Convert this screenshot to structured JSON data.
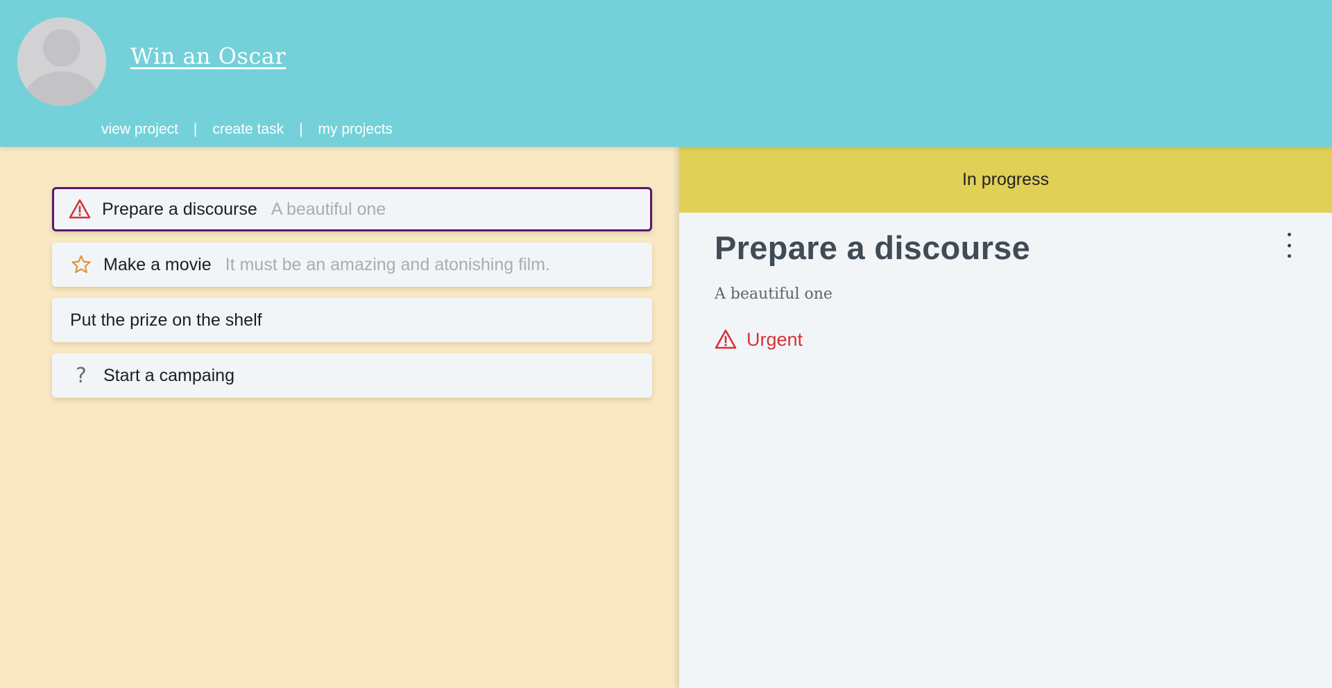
{
  "header": {
    "project_title": "Win an Oscar",
    "nav": [
      {
        "label": "view project"
      },
      {
        "label": "create task"
      },
      {
        "label": "my projects"
      }
    ],
    "separator": "|",
    "bg_color": "#74d1d9"
  },
  "tasks": [
    {
      "title": "Prepare a discourse",
      "description": "A beautiful one",
      "icon": "warning-icon",
      "selected": true
    },
    {
      "title": "Make a movie",
      "description": "It must be an amazing and atonishing film.",
      "icon": "star-icon",
      "selected": false
    },
    {
      "title": "Put the prize on the shelf",
      "description": "",
      "icon": "",
      "selected": false
    },
    {
      "title": "Start a campaing",
      "description": "",
      "icon": "question-icon",
      "selected": false
    }
  ],
  "detail": {
    "status": "In progress",
    "title": "Prepare a discourse",
    "description": "A beautiful one",
    "priority": "Urgent",
    "priority_icon": "warning-icon",
    "menu_icon": "kebab-menu-icon"
  },
  "colors": {
    "left_bg": "#f8e8c4",
    "status_bar": "#e0d056",
    "urgent": "#d63238",
    "star": "#e8913a",
    "selected_border": "#5a1670"
  },
  "icons": {
    "question": "?"
  }
}
